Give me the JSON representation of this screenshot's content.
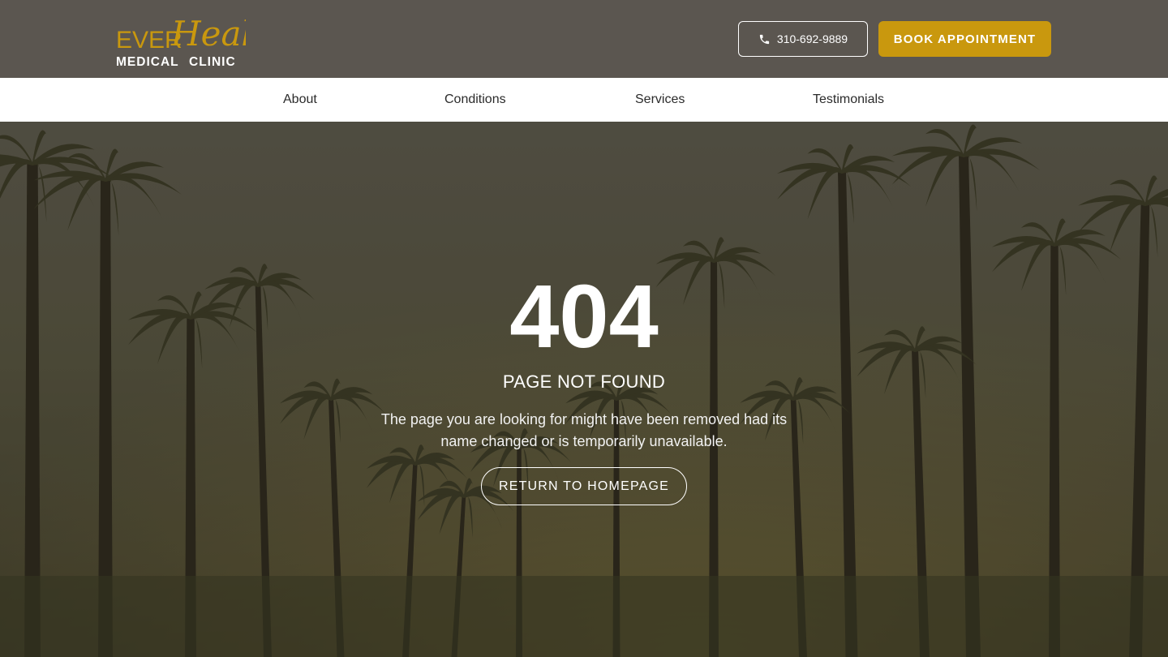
{
  "brand": {
    "logo_word_1": "EVER",
    "logo_word_2": "Heal",
    "logo_tagline_1": "MEDICAL",
    "logo_tagline_2": "CLINIC",
    "gold_color": "#c9980e"
  },
  "header": {
    "phone_icon": "phone-icon",
    "phone_number": "310-692-9889",
    "book_label": "BOOK APPOINTMENT"
  },
  "nav": {
    "items": [
      {
        "label": "About"
      },
      {
        "label": "Conditions"
      },
      {
        "label": "Services"
      },
      {
        "label": "Testimonials"
      }
    ]
  },
  "error": {
    "code": "404",
    "title": "PAGE NOT FOUND",
    "message": "The page you are looking for might have been removed had its name changed or is temporarily unavailable.",
    "button_label": "RETURN TO HOMEPAGE"
  }
}
